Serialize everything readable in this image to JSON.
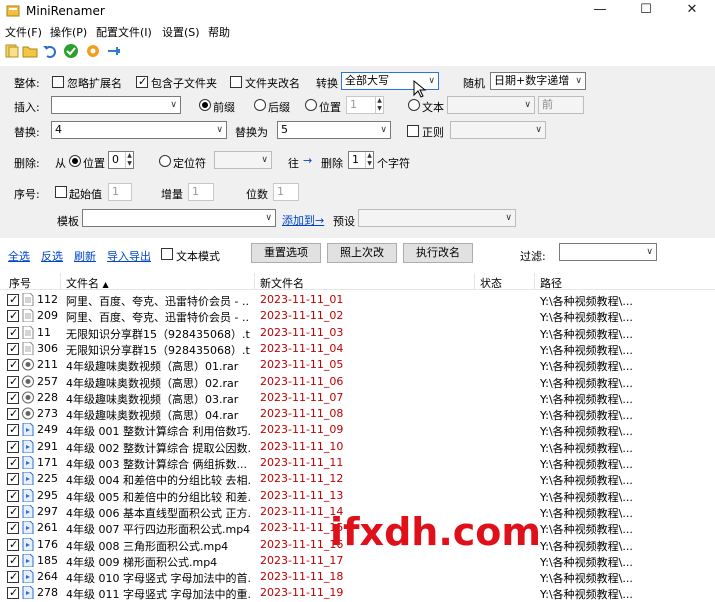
{
  "app": {
    "title": "MiniRenamer",
    "min": "—",
    "max": "☐",
    "close": "✕"
  },
  "menu": [
    "文件(F)",
    "操作(P)",
    "配置文件(I)",
    "设置(S)",
    "帮助"
  ],
  "options": {
    "overall_label": "整体:",
    "ignore_ext": "忽略扩展名",
    "include_sub": "包含子文件夹",
    "folder_rename": "文件夹改名",
    "convert_label": "转换",
    "convert_value": "全部大写",
    "random_label": "随机",
    "random_value": "日期+数字递增",
    "insert_label": "插入:",
    "insert_value": "",
    "prefix": "前缀",
    "suffix": "后缀",
    "position": "位置",
    "position_value": "1",
    "text_label": "文本",
    "text_pos": "前",
    "replace_label": "替换:",
    "replace_value": "4",
    "replace_with_label": "替换为",
    "replace_with_value": "5",
    "regex": "正则",
    "delete_label": "删除:",
    "from_label": "从",
    "del_position": "位置",
    "del_position_value": "0",
    "locator": "定位符",
    "to_label": "往",
    "to_arrow": "→",
    "delete_label2": "删除",
    "delete_count": "1",
    "chars_label": "个字符",
    "seq_label": "序号:",
    "start_label": "起始值",
    "start_value": "1",
    "inc_label": "增量",
    "inc_value": "1",
    "digits_label": "位数",
    "digits_value": "1",
    "template_label": "模板",
    "template_value": "",
    "add_label": "添加到",
    "add_arrow": "→",
    "preset_label": "预设"
  },
  "actions": {
    "select_all": "全选",
    "invert": "反选",
    "refresh": "刷新",
    "import_export": "导入导出",
    "text_mode": "文本模式",
    "reset_btn": "重置选项",
    "last_btn": "照上次改",
    "rename_btn": "执行改名",
    "filter_label": "过滤:",
    "filter_value": ""
  },
  "columns": {
    "seq": "序号",
    "name": "文件名",
    "sort": "▲",
    "newname": "新文件名",
    "status": "状态",
    "path": "路径"
  },
  "rows": [
    {
      "id": "112",
      "name": "阿里、百度、夸克、迅雷特价会员 - ...",
      "new": "2023-11-11_01",
      "path": "Y:\\各种视频教程\\...",
      "icon": "txt"
    },
    {
      "id": "209",
      "name": "阿里、百度、夸克、迅雷特价会员 - ...",
      "new": "2023-11-11_02",
      "path": "Y:\\各种视频教程\\...",
      "icon": "txt"
    },
    {
      "id": "11",
      "name": "无限知识分享群15（928435068）.txt",
      "new": "2023-11-11_03",
      "path": "Y:\\各种视频教程\\...",
      "icon": "txt"
    },
    {
      "id": "306",
      "name": "无限知识分享群15（928435068）.txt",
      "new": "2023-11-11_04",
      "path": "Y:\\各种视频教程\\...",
      "icon": "txt"
    },
    {
      "id": "211",
      "name": "4年级趣味奥数视频（高思）01.rar",
      "new": "2023-11-11_05",
      "path": "Y:\\各种视频教程\\...",
      "icon": "rar"
    },
    {
      "id": "257",
      "name": "4年级趣味奥数视频（高思）02.rar",
      "new": "2023-11-11_06",
      "path": "Y:\\各种视频教程\\...",
      "icon": "rar"
    },
    {
      "id": "228",
      "name": "4年级趣味奥数视频（高思）03.rar",
      "new": "2023-11-11_07",
      "path": "Y:\\各种视频教程\\...",
      "icon": "rar"
    },
    {
      "id": "273",
      "name": "4年级趣味奥数视频（高思）04.rar",
      "new": "2023-11-11_08",
      "path": "Y:\\各种视频教程\\...",
      "icon": "rar"
    },
    {
      "id": "249",
      "name": "4年级 001 整数计算综合 利用倍数巧...",
      "new": "2023-11-11_09",
      "path": "Y:\\各种视频教程\\...",
      "icon": "mp4"
    },
    {
      "id": "291",
      "name": "4年级 002 整数计算综合 提取公因数...",
      "new": "2023-11-11_10",
      "path": "Y:\\各种视频教程\\...",
      "icon": "mp4"
    },
    {
      "id": "171",
      "name": "4年级 003 整数计算综合 俩组拆数...",
      "new": "2023-11-11_11",
      "path": "Y:\\各种视频教程\\...",
      "icon": "mp4"
    },
    {
      "id": "225",
      "name": "4年级 004 和差倍中的分组比较 去相...",
      "new": "2023-11-11_12",
      "path": "Y:\\各种视频教程\\...",
      "icon": "mp4"
    },
    {
      "id": "295",
      "name": "4年级 005 和差倍中的分组比较 和差...",
      "new": "2023-11-11_13",
      "path": "Y:\\各种视频教程\\...",
      "icon": "mp4"
    },
    {
      "id": "297",
      "name": "4年级 006 基本直线型面积公式 正方...",
      "new": "2023-11-11_14",
      "path": "Y:\\各种视频教程\\...",
      "icon": "mp4"
    },
    {
      "id": "261",
      "name": "4年级 007 平行四边形面积公式.mp4",
      "new": "2023-11-11_15",
      "path": "Y:\\各种视频教程\\...",
      "icon": "mp4"
    },
    {
      "id": "176",
      "name": "4年级 008 三角形面积公式.mp4",
      "new": "2023-11-11_16",
      "path": "Y:\\各种视频教程\\...",
      "icon": "mp4"
    },
    {
      "id": "185",
      "name": "4年级 009 梯形面积公式.mp4",
      "new": "2023-11-11_17",
      "path": "Y:\\各种视频教程\\...",
      "icon": "mp4"
    },
    {
      "id": "264",
      "name": "4年级 010 字母竖式 字母加法中的首...",
      "new": "2023-11-11_18",
      "path": "Y:\\各种视频教程\\...",
      "icon": "mp4"
    },
    {
      "id": "278",
      "name": "4年级 011 字母竖式 字母加法中的重...",
      "new": "2023-11-11_19",
      "path": "Y:\\各种视频教程\\...",
      "icon": "mp4"
    }
  ],
  "watermark": "ifxdh.com",
  "colors": {
    "new_name": "#c00000",
    "link": "#0044cc",
    "watermark": "#e0101a"
  }
}
